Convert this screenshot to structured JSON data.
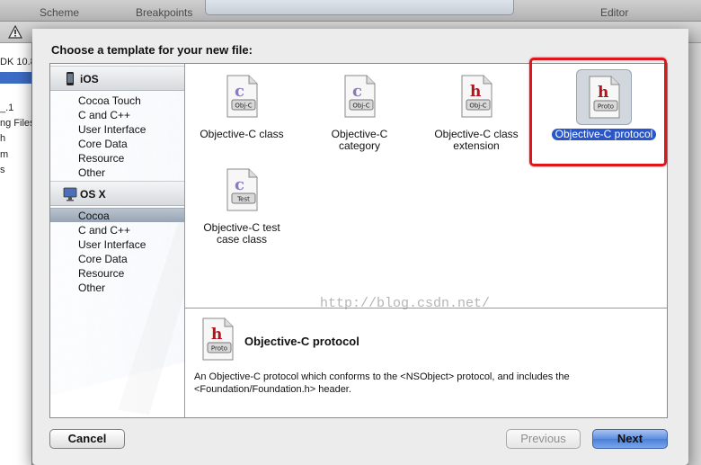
{
  "toolbar": {
    "scheme_label": "Scheme",
    "breakpoints_label": "Breakpoints",
    "editor_label": "Editor"
  },
  "sidebar_fragments": [
    "DK 10.8",
    "_.1",
    "ng Files",
    "h",
    "m",
    "s"
  ],
  "dialog": {
    "title": "Choose a template for your new file:",
    "groups": [
      {
        "label": "iOS",
        "icon": "iphone-icon",
        "items": [
          "Cocoa Touch",
          "C and C++",
          "User Interface",
          "Core Data",
          "Resource",
          "Other"
        ]
      },
      {
        "label": "OS X",
        "icon": "mac-icon",
        "items": [
          "Cocoa",
          "C and C++",
          "User Interface",
          "Core Data",
          "Resource",
          "Other"
        ]
      }
    ],
    "selected_category": "Cocoa",
    "templates": [
      {
        "label_line1": "Objective-C class",
        "label_line2": "",
        "badge": "Obj-C",
        "letter": ""
      },
      {
        "label_line1": "Objective-C",
        "label_line2": "category",
        "badge": "Obj-C",
        "letter": ""
      },
      {
        "label_line1": "Objective-C class",
        "label_line2": "extension",
        "badge": "Obj-C",
        "letter": "h"
      },
      {
        "label_line1": "Objective-C protocol",
        "label_line2": "",
        "badge": "Proto",
        "letter": "h"
      },
      {
        "label_line1": "Objective-C test",
        "label_line2": "case class",
        "badge": "Test",
        "letter": ""
      }
    ],
    "selected_template": "Objective-C protocol",
    "description": {
      "title": "Objective-C protocol",
      "badge": "Proto",
      "letter": "h",
      "text_line1": "An Objective-C protocol which conforms to the <NSObject> protocol, and includes the",
      "text_line2": "<Foundation/Foundation.h> header."
    },
    "buttons": {
      "cancel": "Cancel",
      "previous": "Previous",
      "next": "Next"
    }
  },
  "watermark": "http://blog.csdn.net/",
  "colors": {
    "selection_blue": "#2956c8",
    "highlight_red": "#e0141b",
    "letter_red": "#b3121a"
  }
}
